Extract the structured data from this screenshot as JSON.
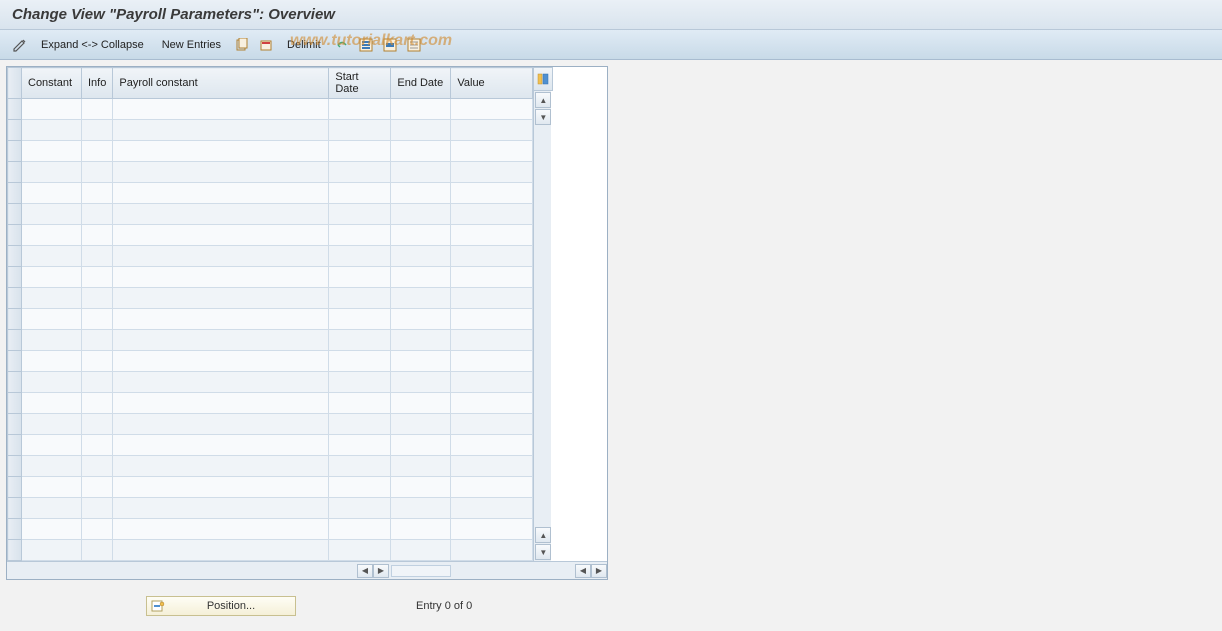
{
  "header": {
    "title": "Change View \"Payroll Parameters\": Overview"
  },
  "toolbar": {
    "expand_collapse": "Expand <-> Collapse",
    "new_entries": "New Entries",
    "delimit": "Delimit"
  },
  "watermark": "www.tutorialkart.com",
  "table": {
    "columns": {
      "constant": "Constant",
      "info": "Info",
      "payroll_constant": "Payroll constant",
      "start_date": "Start Date",
      "end_date": "End Date",
      "value": "Value"
    },
    "rows": [
      {},
      {},
      {},
      {},
      {},
      {},
      {},
      {},
      {},
      {},
      {},
      {},
      {},
      {},
      {},
      {},
      {},
      {},
      {},
      {},
      {},
      {}
    ]
  },
  "footer": {
    "position_label": "Position...",
    "entry_text": "Entry 0 of 0"
  }
}
